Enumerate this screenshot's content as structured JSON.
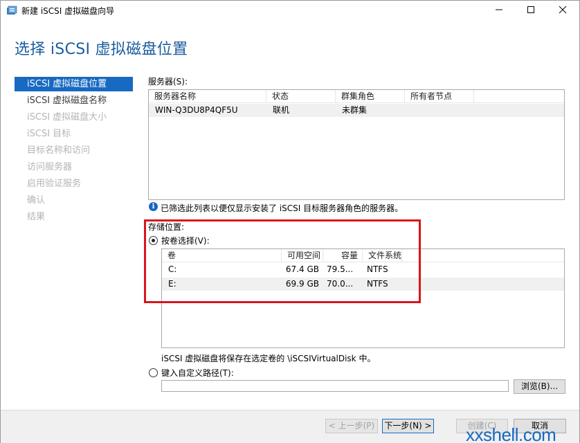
{
  "window": {
    "title": "新建 iSCSI 虚拟磁盘向导",
    "heading": "选择 iSCSI 虚拟磁盘位置"
  },
  "nav": {
    "items": [
      {
        "label": "iSCSI 虚拟磁盘位置",
        "state": "active"
      },
      {
        "label": "iSCSI 虚拟磁盘名称",
        "state": "enabled"
      },
      {
        "label": "iSCSI 虚拟磁盘大小",
        "state": "disabled"
      },
      {
        "label": "iSCSI 目标",
        "state": "disabled"
      },
      {
        "label": "目标名称和访问",
        "state": "disabled"
      },
      {
        "label": "访问服务器",
        "state": "disabled"
      },
      {
        "label": "启用验证服务",
        "state": "disabled"
      },
      {
        "label": "确认",
        "state": "disabled"
      },
      {
        "label": "结果",
        "state": "disabled"
      }
    ]
  },
  "servers": {
    "label": "服务器(S):",
    "columns": [
      "服务器名称",
      "状态",
      "群集角色",
      "所有者节点"
    ],
    "rows": [
      {
        "name": "WIN-Q3DU8P4QF5U",
        "status": "联机",
        "cluster_role": "未群集",
        "owner": ""
      }
    ],
    "info_text": "已筛选此列表以便仅显示安装了 iSCSI 目标服务器角色的服务器。"
  },
  "storage": {
    "label": "存储位置:",
    "by_volume_label": "按卷选择(V):",
    "by_volume_selected": true,
    "columns": [
      "卷",
      "可用空间",
      "容量",
      "文件系统"
    ],
    "rows": [
      {
        "volume": "C:",
        "free": "67.4 GB",
        "capacity": "79.5...",
        "fs": "NTFS"
      },
      {
        "volume": "E:",
        "free": "69.9 GB",
        "capacity": "70.0...",
        "fs": "NTFS"
      }
    ],
    "save_note": "iSCSI 虚拟磁盘将保存在选定卷的 \\iSCSIVirtualDisk 中。",
    "custom_path_label": "键入自定义路径(T):",
    "custom_path_value": "",
    "browse_label": "浏览(B)..."
  },
  "footer": {
    "prev_label": "< 上一步(P)",
    "next_label": "下一步(N) >",
    "create_label": "创建(C)",
    "cancel_label": "取消"
  },
  "watermark": "xxshell.com",
  "colors": {
    "accent": "#1769c2",
    "heading": "#1b5c9e",
    "highlight_box": "#d9141b"
  }
}
